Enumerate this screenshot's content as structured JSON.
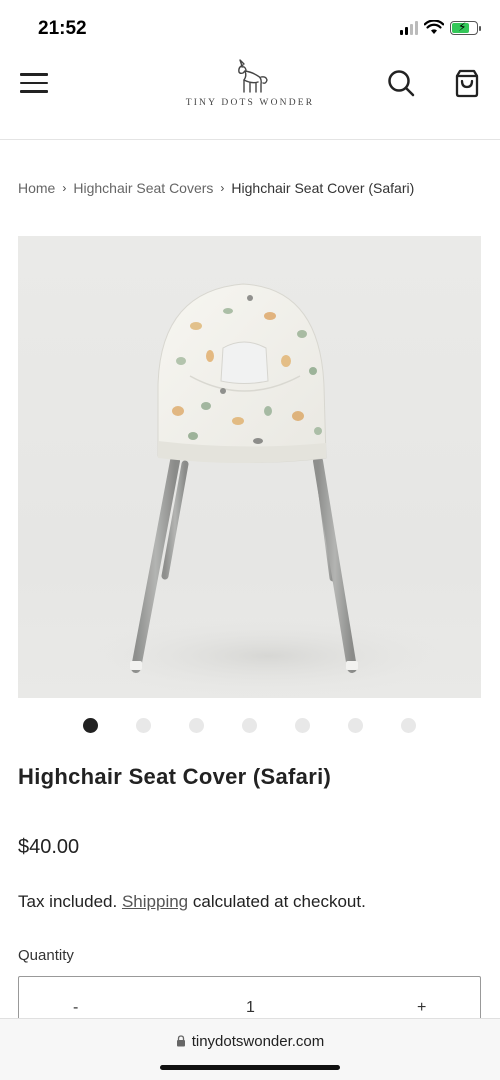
{
  "status_bar": {
    "time": "21:52"
  },
  "header": {
    "brand": "TINY DOTS WONDER"
  },
  "breadcrumb": {
    "items": [
      "Home",
      "Highchair Seat Covers",
      "Highchair Seat Cover (Safari)"
    ],
    "separator": "›"
  },
  "gallery": {
    "image_count": 7,
    "active_index": 0
  },
  "product": {
    "title": "Highchair Seat Cover (Safari)",
    "price": "$40.00",
    "tax_prefix": "Tax included.",
    "shipping_link": "Shipping",
    "tax_suffix": "calculated at checkout."
  },
  "quantity": {
    "label": "Quantity",
    "minus": "-",
    "value": "1",
    "plus": "+"
  },
  "browser": {
    "url": "tinydotswonder.com"
  },
  "colors": {
    "battery": "#34c759",
    "active_dot": "#222222",
    "inactive_dot": "#e8e8e8"
  }
}
